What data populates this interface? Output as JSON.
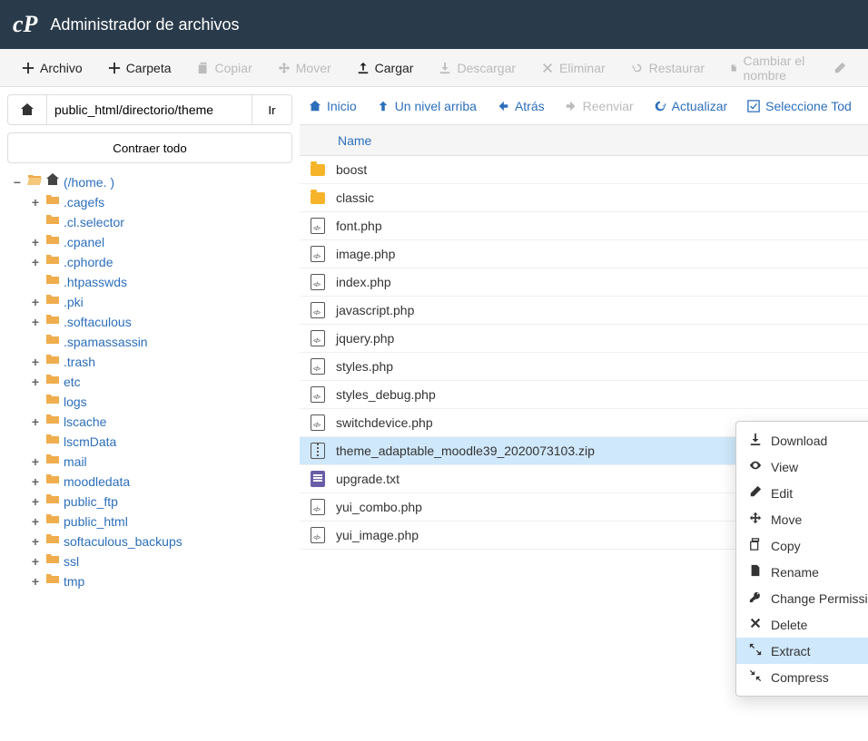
{
  "header": {
    "title": "Administrador de archivos"
  },
  "toolbar": {
    "file": "Archivo",
    "folder": "Carpeta",
    "copy": "Copiar",
    "move": "Mover",
    "upload": "Cargar",
    "download": "Descargar",
    "delete": "Eliminar",
    "restore": "Restaurar",
    "rename": "Cambiar el nombre"
  },
  "path": {
    "value": "public_html/directorio/theme",
    "go": "Ir"
  },
  "collapse_all": "Contraer todo",
  "tree": {
    "root": "(/home.               )",
    "children": [
      {
        "name": ".cagefs",
        "expandable": true
      },
      {
        "name": ".cl.selector",
        "expandable": false
      },
      {
        "name": ".cpanel",
        "expandable": true
      },
      {
        "name": ".cphorde",
        "expandable": true
      },
      {
        "name": ".htpasswds",
        "expandable": false
      },
      {
        "name": ".pki",
        "expandable": true
      },
      {
        "name": ".softaculous",
        "expandable": true
      },
      {
        "name": ".spamassassin",
        "expandable": false
      },
      {
        "name": ".trash",
        "expandable": true
      },
      {
        "name": "etc",
        "expandable": true
      },
      {
        "name": "logs",
        "expandable": false
      },
      {
        "name": "lscache",
        "expandable": true
      },
      {
        "name": "lscmData",
        "expandable": false
      },
      {
        "name": "mail",
        "expandable": true
      },
      {
        "name": "moodledata",
        "expandable": true
      },
      {
        "name": "public_ftp",
        "expandable": true
      },
      {
        "name": "public_html",
        "expandable": true
      },
      {
        "name": "softaculous_backups",
        "expandable": true
      },
      {
        "name": "ssl",
        "expandable": true
      },
      {
        "name": "tmp",
        "expandable": true
      }
    ]
  },
  "nav": {
    "home": "Inicio",
    "up": "Un nivel arriba",
    "back": "Atrás",
    "forward": "Reenviar",
    "reload": "Actualizar",
    "select_all": "Seleccione Tod"
  },
  "table": {
    "name_col": "Name"
  },
  "files": [
    {
      "name": "boost",
      "type": "folder"
    },
    {
      "name": "classic",
      "type": "folder"
    },
    {
      "name": "font.php",
      "type": "code"
    },
    {
      "name": "image.php",
      "type": "code"
    },
    {
      "name": "index.php",
      "type": "code"
    },
    {
      "name": "javascript.php",
      "type": "code"
    },
    {
      "name": "jquery.php",
      "type": "code"
    },
    {
      "name": "styles.php",
      "type": "code"
    },
    {
      "name": "styles_debug.php",
      "type": "code"
    },
    {
      "name": "switchdevice.php",
      "type": "code"
    },
    {
      "name": "theme_adaptable_moodle39_2020073103.zip",
      "type": "zip",
      "selected": true
    },
    {
      "name": "upgrade.txt",
      "type": "txt"
    },
    {
      "name": "yui_combo.php",
      "type": "code"
    },
    {
      "name": "yui_image.php",
      "type": "code"
    }
  ],
  "context_menu": [
    {
      "label": "Download",
      "icon": "download"
    },
    {
      "label": "View",
      "icon": "eye"
    },
    {
      "label": "Edit",
      "icon": "pencil"
    },
    {
      "label": "Move",
      "icon": "move"
    },
    {
      "label": "Copy",
      "icon": "copy"
    },
    {
      "label": "Rename",
      "icon": "file"
    },
    {
      "label": "Change Permissions",
      "icon": "key"
    },
    {
      "label": "Delete",
      "icon": "x"
    },
    {
      "label": "Extract",
      "icon": "expand",
      "hover": true
    },
    {
      "label": "Compress",
      "icon": "compress"
    }
  ]
}
